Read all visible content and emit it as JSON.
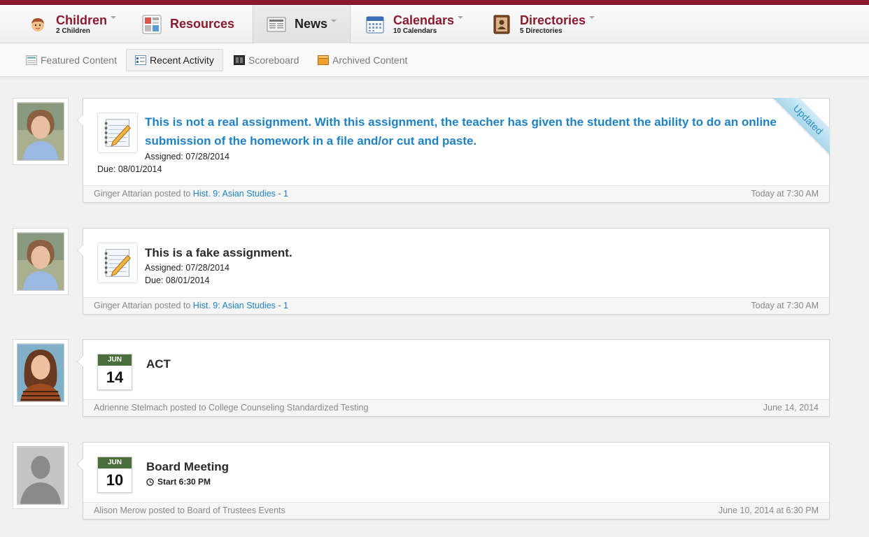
{
  "nav": {
    "children": {
      "label": "Children",
      "sub": "2 Children"
    },
    "resources": {
      "label": "Resources"
    },
    "news": {
      "label": "News"
    },
    "calendars": {
      "label": "Calendars",
      "sub": "10 Calendars"
    },
    "directories": {
      "label": "Directories",
      "sub": "5 Directories"
    }
  },
  "subnav": {
    "featured": "Featured Content",
    "recent": "Recent Activity",
    "scoreboard": "Scoreboard",
    "archived": "Archived Content"
  },
  "posts": [
    {
      "title": "This is not a real assignment. With this assignment, the teacher has given the student the ability to do an online submission of the homework in a file and/or cut and paste.",
      "assigned": "Assigned: 07/28/2014",
      "due": "Due: 08/01/2014",
      "ribbon": "Updated",
      "author": "Ginger Attarian",
      "posted_to": "posted to",
      "context": "Hist. 9: Asian Studies - 1",
      "time": "Today at 7:30 AM"
    },
    {
      "title": "This is a fake assignment.",
      "assigned": "Assigned: 07/28/2014",
      "due": "Due: 08/01/2014",
      "author": "Ginger Attarian",
      "posted_to": "posted to",
      "context": "Hist. 9: Asian Studies - 1",
      "time": "Today at 7:30 AM"
    },
    {
      "title": "ACT",
      "month": "JUN",
      "day": "14",
      "author": "Adrienne Stelmach",
      "posted_to": "posted to College Counseling Standardized Testing",
      "time": "June 14, 2014"
    },
    {
      "title": "Board Meeting",
      "month": "JUN",
      "day": "10",
      "start": "Start 6:30 PM",
      "author": "Alison Merow",
      "posted_to": "posted to Board of Trustees Events",
      "time": "June 10, 2014 at 6:30 PM"
    }
  ],
  "colors": {
    "brand": "#8c1a2f",
    "link": "#1e82c4",
    "calendar_header": "#4a6e3a"
  }
}
